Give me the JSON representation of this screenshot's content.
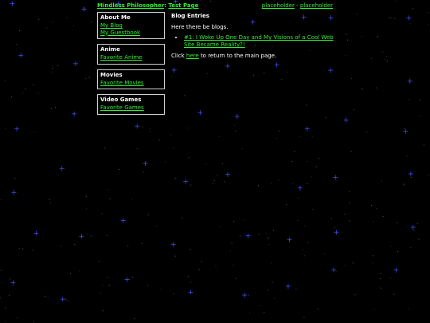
{
  "header": {
    "site_link": "Mindless Philosopher",
    "separator": ":",
    "page_link": "Test Page",
    "right_link_1": "placeholder",
    "right_separator": "-",
    "right_link_2": "placeholder"
  },
  "sidebar": {
    "boxes": [
      {
        "title": "About Me",
        "links": [
          "My Blog",
          "My Guestbook"
        ]
      },
      {
        "title": "Anime",
        "links": [
          "Favorite Anime"
        ]
      },
      {
        "title": "Movies",
        "links": [
          "Favorite Movies"
        ]
      },
      {
        "title": "Video Games",
        "links": [
          "Favorite Games"
        ]
      }
    ]
  },
  "main": {
    "heading": "Blog Entries",
    "intro": "Here there be blogs.",
    "entries": [
      "#1: I Woke Up One Day and My Visions of a Cool Web Site Became Reality?!"
    ],
    "return_prefix": "Click",
    "return_link": "here",
    "return_suffix": "to return to the main page."
  },
  "colors": {
    "background": "#000000",
    "link": "#33ee33",
    "text": "#ffffff",
    "border": "#cfcfcf",
    "star": "#4455ff"
  }
}
